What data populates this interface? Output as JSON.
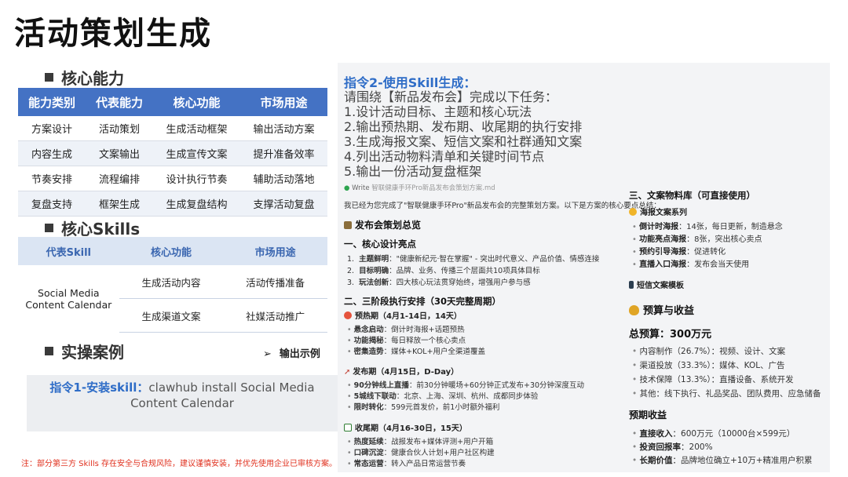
{
  "title": "活动策划生成",
  "sections": {
    "core_ability": "核心能力",
    "core_skills": "核心Skills",
    "cases": "实操案例",
    "output_example": "输出示例"
  },
  "capability_table": {
    "headers": [
      "能力类别",
      "代表能力",
      "核心功能",
      "市场用途"
    ],
    "rows": [
      [
        "方案设计",
        "活动策划",
        "生成活动框架",
        "输出活动方案"
      ],
      [
        "内容生成",
        "文案输出",
        "生成宣传文案",
        "提升准备效率"
      ],
      [
        "节奏安排",
        "流程编排",
        "设计执行节奏",
        "辅助活动落地"
      ],
      [
        "复盘支持",
        "框架生成",
        "生成复盘结构",
        "支撑活动复盘"
      ]
    ]
  },
  "skills_table": {
    "headers": [
      "代表Skill",
      "核心功能",
      "市场用途"
    ],
    "skill_name": "Social Media Content Calendar",
    "rows": [
      [
        "生成活动内容",
        "活动传播准备"
      ],
      [
        "生成渠道文案",
        "社媒活动推广"
      ]
    ]
  },
  "cmd1": {
    "label": "指令1-安装skill：",
    "text": "clawhub install Social Media Content Calendar"
  },
  "footnote": "注：部分第三方 Skills 存在安全与合规风险，建议谨慎安装，并优先使用企业已审核方案。",
  "cmd2": {
    "title": "指令2-使用Skill生成：",
    "intro": "请围绕【新品发布会】完成以下任务：",
    "tasks": [
      "1.设计活动目标、主题和核心玩法",
      "2.输出预热期、发布期、收尾期的执行安排",
      "3.生成海报文案、短信文案和社群通知文案",
      "4.列出活动物料清单和关键时间节点",
      "5.输出一份活动复盘框架"
    ]
  },
  "doc": {
    "write_label": "Write",
    "file": "智联健康手环Pro新品发布会策划方案.md",
    "intro": "我已经为您完成了\"智联健康手环Pro\"新品发布会的完整策划方案。以下是方案的核心要点总结：",
    "overview": "发布会策划总览",
    "design_title": "一、核心设计亮点",
    "design_items": [
      {
        "k": "主题鲜明",
        "v": "\"健康新纪元·智在掌握\" - 突出时代意义、产品价值、情感连接"
      },
      {
        "k": "目标明确",
        "v": "品牌、业务、传播三个层面共10项具体目标"
      },
      {
        "k": "玩法创新",
        "v": "四大核心玩法贯穿始终，增强用户参与感"
      }
    ],
    "phase_title": "二、三阶段执行安排（30天完整周期）",
    "phases": [
      {
        "name": "预热期（4月1-14日，14天）",
        "items": [
          {
            "k": "悬念启动",
            "v": "倒计时海报+话题预热"
          },
          {
            "k": "功能揭秘",
            "v": "每日释放一个核心卖点"
          },
          {
            "k": "密集造势",
            "v": "媒体+KOL+用户全渠道覆盖"
          }
        ]
      },
      {
        "name": "发布期（4月15日，D-Day）",
        "items": [
          {
            "k": "90分钟线上直播",
            "v": "前30分钟暖场+60分钟正式发布+30分钟深度互动"
          },
          {
            "k": "5城线下联动",
            "v": "北京、上海、深圳、杭州、成都同步体验"
          },
          {
            "k": "限时转化",
            "v": "599元首发价，前1小时额外福利"
          }
        ]
      },
      {
        "name": "收尾期（4月16-30日，15天）",
        "items": [
          {
            "k": "热度延续",
            "v": "战报发布+媒体评测+用户开箱"
          },
          {
            "k": "口碑沉淀",
            "v": "健康合伙人计划+用户社区构建"
          },
          {
            "k": "常态运营",
            "v": "转入产品日常运营节奏"
          }
        ]
      }
    ],
    "material_title": "三、文案物料库（可直接使用）",
    "poster_title": "海报文案系列",
    "poster_items": [
      {
        "k": "倒计时海报",
        "v": "：14张，每日更新，制造悬念"
      },
      {
        "k": "功能亮点海报",
        "v": "：8张，突出核心卖点"
      },
      {
        "k": "预约引导海报",
        "v": "：促进转化"
      },
      {
        "k": "直播入口海报",
        "v": "：发布会当天使用"
      }
    ],
    "sms_title": "短信文案模板",
    "budget_title": "预算与收益",
    "total_budget": "总预算：300万元",
    "budget_items": [
      "内容制作（26.7%）：视频、设计、文案",
      "渠道投放（33.3%）：媒体、KOL、广告",
      "技术保障（13.3%）：直播设备、系统开发",
      "其他：线下执行、礼品奖品、团队费用、应急储备"
    ],
    "revenue_title": "预期收益",
    "revenue_items": [
      {
        "k": "直接收入",
        "v": "：600万元（10000台×599元）"
      },
      {
        "k": "投资回报率",
        "v": "：200%"
      },
      {
        "k": "长期价值",
        "v": "：品牌地位确立+10万+精准用户积累"
      }
    ]
  },
  "colors": {
    "table_header": "#4472c4",
    "accent_blue": "#2f6dc7",
    "warning_red": "#e0301e"
  }
}
